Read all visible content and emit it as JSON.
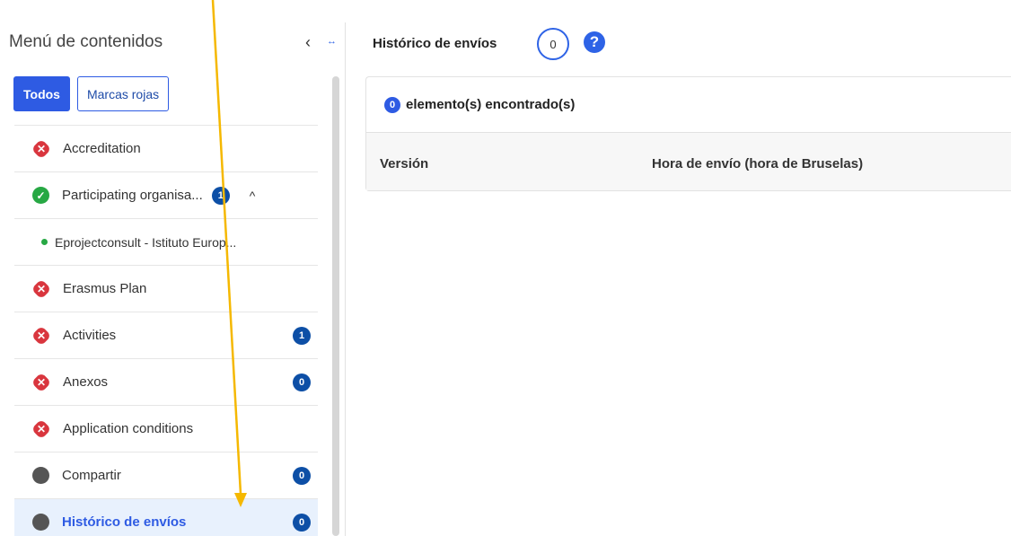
{
  "sidebar": {
    "title": "Menú de contenidos",
    "filters": {
      "all": "Todos",
      "red_flags": "Marcas rojas"
    },
    "items": [
      {
        "label": "Accreditation",
        "status": "error"
      },
      {
        "label": "Participating organisa...",
        "status": "ok",
        "badge": "1"
      },
      {
        "label": "Eprojectconsult - Istituto Europ...",
        "status": "sub-ok"
      },
      {
        "label": "Erasmus Plan",
        "status": "error"
      },
      {
        "label": "Activities",
        "status": "error",
        "badge": "1"
      },
      {
        "label": "Anexos",
        "status": "error",
        "badge": "0"
      },
      {
        "label": "Application conditions",
        "status": "error"
      },
      {
        "label": "Compartir",
        "status": "none",
        "badge": "0"
      },
      {
        "label": "Histórico de envíos",
        "status": "none",
        "badge": "0",
        "active": true
      }
    ]
  },
  "main": {
    "title": "Histórico de envíos",
    "count": "0",
    "found_count": "0",
    "found_label": "elemento(s) encontrado(s)",
    "columns": {
      "version": "Versión",
      "time": "Hora de envío (hora de Bruselas)"
    }
  },
  "colors": {
    "primary": "#2e5be3",
    "error": "#d9363e",
    "ok": "#27a844",
    "badge": "#0d4fa6",
    "arrow": "#f5b800"
  }
}
